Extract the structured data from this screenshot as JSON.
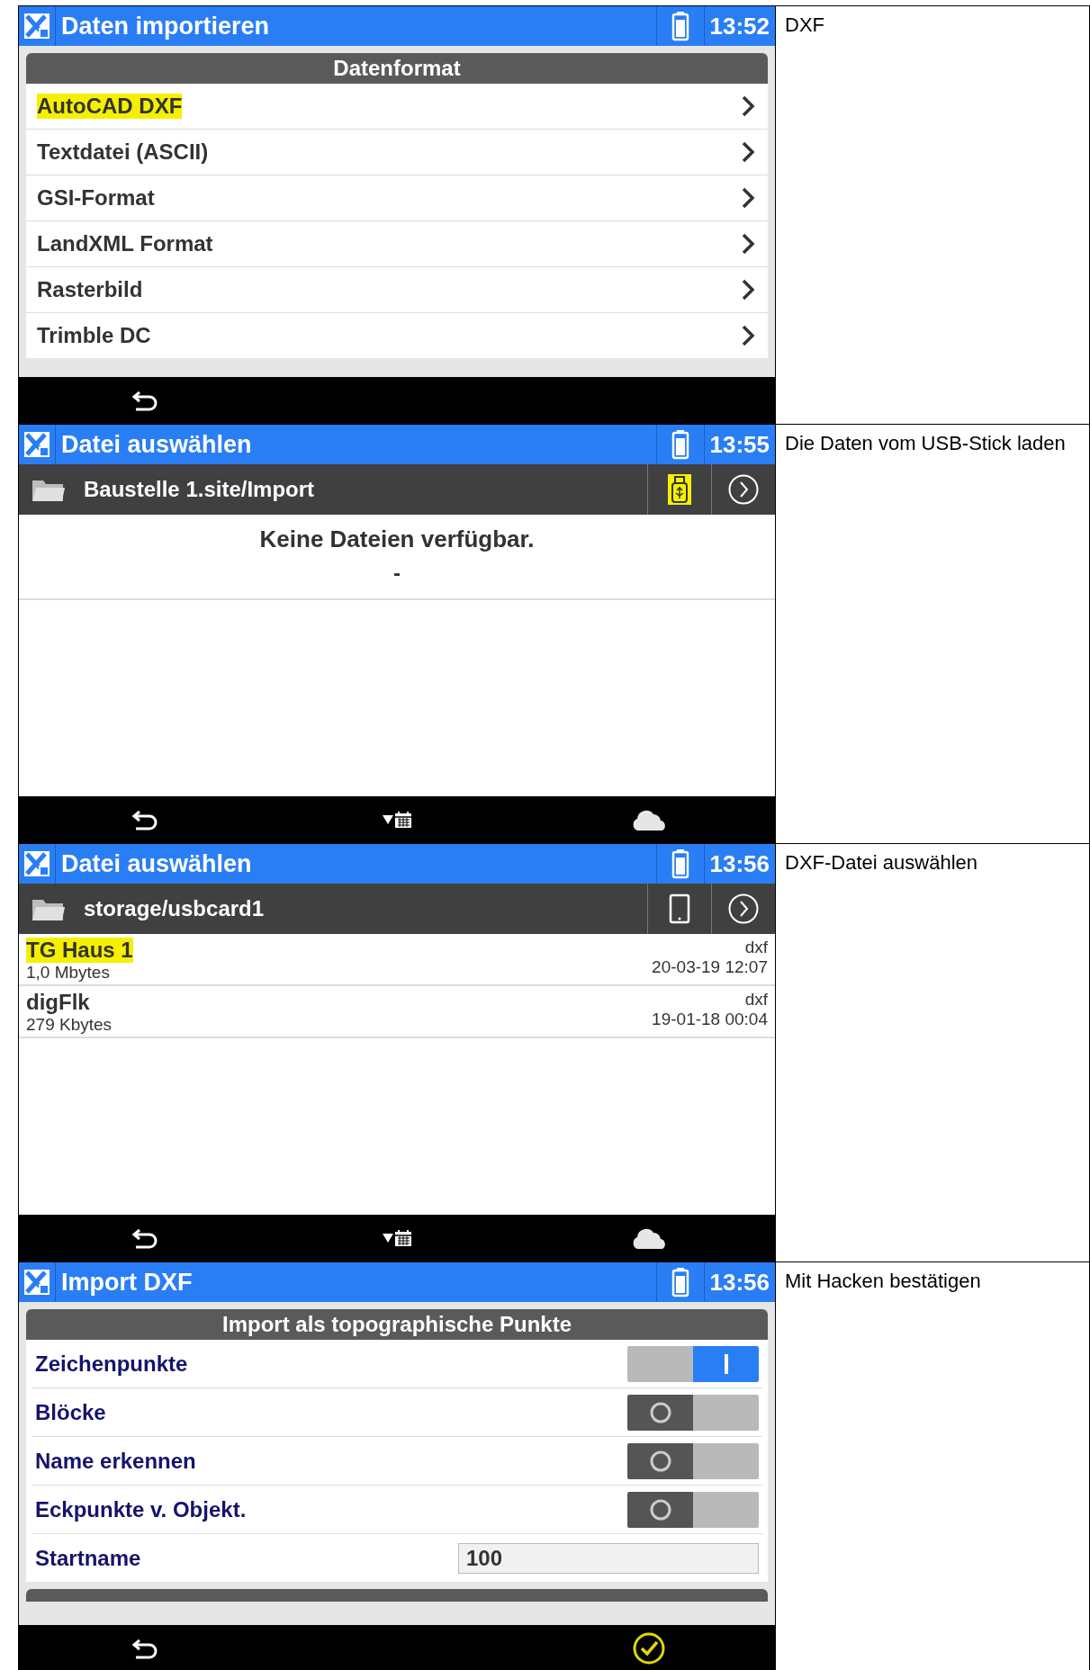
{
  "rows": [
    {
      "screen": {
        "kind": "menu",
        "title": "Daten importieren",
        "time": "13:52",
        "section": "Datenformat",
        "items": [
          {
            "label": "AutoCAD DXF",
            "highlighted": true
          },
          {
            "label": "Textdatei (ASCII)",
            "highlighted": false
          },
          {
            "label": "GSI-Format",
            "highlighted": false
          },
          {
            "label": "LandXML Format",
            "highlighted": false
          },
          {
            "label": "Rasterbild",
            "highlighted": false
          },
          {
            "label": "Trimble DC",
            "highlighted": false
          }
        ],
        "bottom_buttons": [
          {
            "kind": "back"
          }
        ]
      },
      "caption": "DXF"
    },
    {
      "screen": {
        "kind": "file_browser",
        "title": "Datei auswählen",
        "time": "13:55",
        "path": "Baustelle 1.site/Import",
        "storage": {
          "kind": "usb",
          "highlighted": true
        },
        "empty_message": "Keine Dateien verfügbar.",
        "empty_detail": "-",
        "bottom_buttons": [
          {
            "kind": "back"
          },
          {
            "kind": "filter"
          },
          {
            "kind": "cloud"
          }
        ]
      },
      "caption": "Die Daten vom USB-Stick laden"
    },
    {
      "screen": {
        "kind": "file_browser",
        "title": "Datei auswählen",
        "time": "13:56",
        "path": "storage/usbcard1",
        "storage": {
          "kind": "tablet",
          "highlighted": false
        },
        "files": [
          {
            "name": "TG Haus 1",
            "size": "1,0 Mbytes",
            "type": "dxf",
            "date": "20-03-19 12:07",
            "highlighted": true
          },
          {
            "name": "digFlk",
            "size": "279 Kbytes",
            "type": "dxf",
            "date": "19-01-18 00:04",
            "highlighted": false
          }
        ],
        "bottom_buttons": [
          {
            "kind": "back"
          },
          {
            "kind": "filter"
          },
          {
            "kind": "cloud"
          }
        ]
      },
      "caption": "DXF-Datei auswählen"
    },
    {
      "screen": {
        "kind": "options",
        "title": "Import DXF",
        "time": "13:56",
        "section": "Import als topographische Punkte",
        "options": [
          {
            "kind": "toggle",
            "label": "Zeichenpunkte",
            "on": true
          },
          {
            "kind": "toggle",
            "label": "Blöcke",
            "on": false
          },
          {
            "kind": "toggle",
            "label": "Name erkennen",
            "on": false
          },
          {
            "kind": "toggle",
            "label": "Eckpunkte v. Objekt.",
            "on": false
          },
          {
            "kind": "input",
            "label": "Startname",
            "value": "100"
          }
        ],
        "more_section": true,
        "bottom_buttons": [
          {
            "kind": "back"
          },
          {
            "kind": "confirm"
          }
        ]
      },
      "caption": "Mit Hacken bestätigen"
    }
  ]
}
